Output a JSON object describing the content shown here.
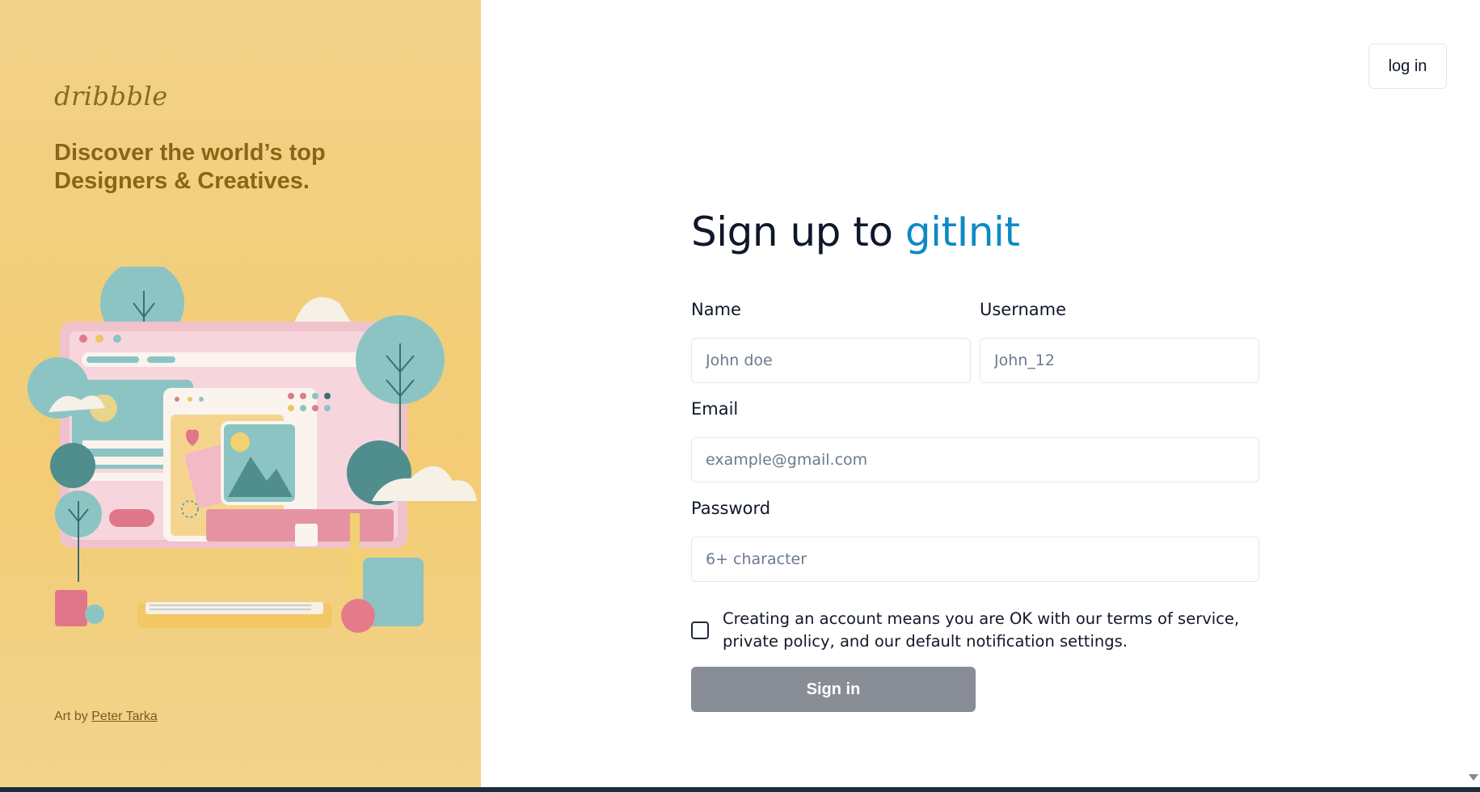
{
  "left_panel": {
    "brand": "dribbble",
    "tagline_line1": "Discover the world’s top",
    "tagline_line2": "Designers & Creatives.",
    "art_by": "Art by",
    "artist": "Peter Tarka"
  },
  "header": {
    "login_label": "log in"
  },
  "form": {
    "title_prefix": "Sign up to",
    "title_brand": "gitInit",
    "name_label": "Name",
    "name_placeholder": "John doe",
    "username_label": "Username",
    "username_placeholder": "John_12",
    "email_label": "Email",
    "email_placeholder": "example@gmail.com",
    "password_label": "Password",
    "password_placeholder": "6+ character",
    "terms_line1": "Creating an account means you are OK with our terms of service,",
    "terms_line2": "private policy, and our default notification settings.",
    "terms_checked": false,
    "submit_label": "Sign in"
  },
  "colors": {
    "brand_accent": "#0f89c6",
    "left_panel_bg": "#f2d28a",
    "submit_bg": "#888d96"
  }
}
